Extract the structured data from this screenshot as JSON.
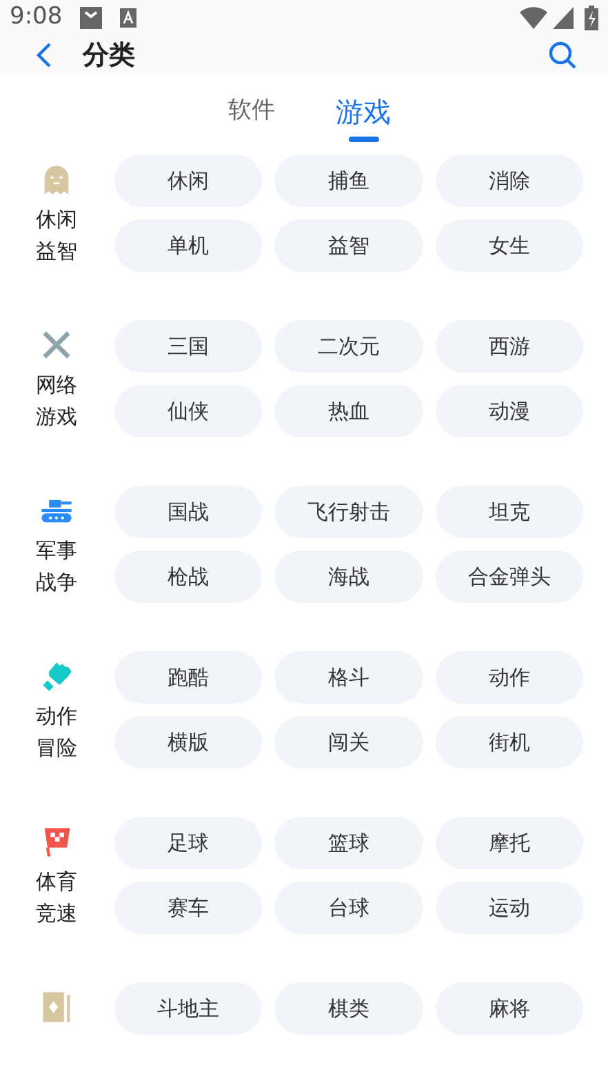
{
  "status_bar": {
    "time": "9:08"
  },
  "header": {
    "title": "分类"
  },
  "tabs": [
    {
      "label": "软件",
      "selected": false
    },
    {
      "label": "游戏",
      "selected": true
    }
  ],
  "categories": [
    {
      "name_lines": [
        "休闲",
        "益智"
      ],
      "tags": [
        "休闲",
        "捕鱼",
        "消除",
        "单机",
        "益智",
        "女生"
      ]
    },
    {
      "name_lines": [
        "网络",
        "游戏"
      ],
      "tags": [
        "三国",
        "二次元",
        "西游",
        "仙侠",
        "热血",
        "动漫"
      ]
    },
    {
      "name_lines": [
        "军事",
        "战争"
      ],
      "tags": [
        "国战",
        "飞行射击",
        "坦克",
        "枪战",
        "海战",
        "合金弹头"
      ]
    },
    {
      "name_lines": [
        "动作",
        "冒险"
      ],
      "tags": [
        "跑酷",
        "格斗",
        "动作",
        "横版",
        "闯关",
        "街机"
      ]
    },
    {
      "name_lines": [
        "体育",
        "竞速"
      ],
      "tags": [
        "足球",
        "篮球",
        "摩托",
        "赛车",
        "台球",
        "运动"
      ]
    },
    {
      "tags": [
        "斗地主",
        "棋类",
        "麻将"
      ]
    }
  ]
}
